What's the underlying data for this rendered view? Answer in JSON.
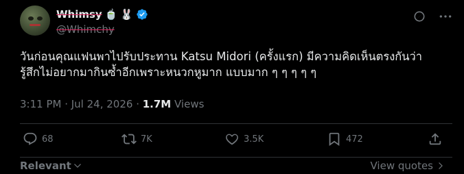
{
  "user": {
    "display_name": "Whimsy",
    "emoji_1": "🍵",
    "emoji_2": "🐰",
    "handle": "@Whimchy"
  },
  "tweet": {
    "text_line1": "วันก่อนคุณแฟนพาไปรับประทาน Katsu Midori (ครั้งแรก) มีความคิดเห็นตรงกันว่า",
    "text_line2": "รู้สึกไม่อยากมากินซ้ำอีกเพราะหนวกหูมาก แบบมาก ๆ ๆ ๆ ๆ ๆ",
    "timestamp": "3:11 PM · Jul 24, 2026",
    "separator": " · ",
    "views_count": "1.7M",
    "views_label": " Views"
  },
  "actions": {
    "replies": "68",
    "reposts": "7K",
    "likes": "3.5K",
    "bookmarks": "472"
  },
  "footer": {
    "sort_label": "Relevant",
    "view_quotes": "View quotes"
  },
  "colors": {
    "background": "#000000",
    "text": "#e7e9ea",
    "muted": "#71767b",
    "verified": "#1d9bf0",
    "divider": "#2f3336"
  }
}
